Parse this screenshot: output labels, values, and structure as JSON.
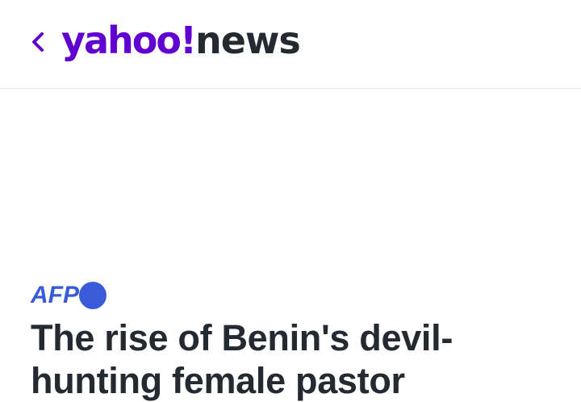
{
  "header": {
    "back_icon": "chevron-left-icon",
    "logo_yahoo": "yahoo!",
    "logo_news": "news",
    "brand_color": "#6001d2",
    "text_color": "#232a31"
  },
  "article": {
    "publisher": "AFP",
    "publisher_color": "#3a5bd9",
    "headline": "The rise of Benin's devil-hunting female pastor"
  }
}
